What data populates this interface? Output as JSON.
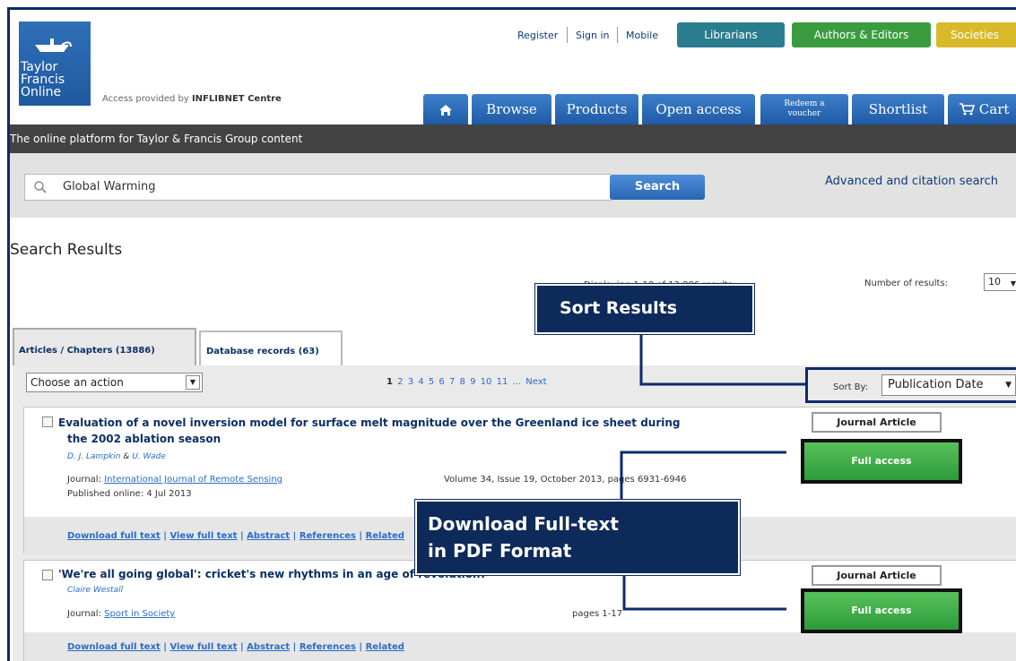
{
  "header": {
    "logo_lines": [
      "Taylor",
      "Francis",
      "Online"
    ],
    "access_prefix": "Access provided by",
    "access_org": "INFLIBNET Centre",
    "links": {
      "register": "Register",
      "sign_in": "Sign in",
      "mobile": "Mobile"
    },
    "pills": {
      "librarians": "Librarians",
      "authors": "Authors & Editors",
      "societies": "Societies"
    },
    "nav": {
      "browse": "Browse",
      "products": "Products",
      "open_access": "Open access",
      "redeem_1": "Redeem a",
      "redeem_2": "voucher",
      "shortlist": "Shortlist",
      "cart": "Cart"
    },
    "tagline": "The online platform for Taylor & Francis Group content"
  },
  "search": {
    "value": "Global Warming",
    "button": "Search",
    "advanced": "Advanced and citation search"
  },
  "results": {
    "heading": "Search Results",
    "count_text": "Displaying 1-10 of 13,886 results",
    "per_page_label": "Number of results:",
    "per_page_value": "10",
    "tabs": {
      "articles": "Articles / Chapters (13886)",
      "database": "Database records (63)"
    },
    "action_select": "Choose an action",
    "pages": [
      "1",
      "2",
      "3",
      "4",
      "5",
      "6",
      "7",
      "8",
      "9",
      "10",
      "11",
      "...",
      "Next"
    ],
    "sort_label": "Sort By:",
    "sort_value": "Publication Date",
    "items": [
      {
        "title_line1": "Evaluation of a novel inversion model for surface melt magnitude over the Greenland ice sheet during",
        "title_line2": "the 2002 ablation season",
        "author1": "D. J. Lampkin",
        "amp": "&",
        "author2": "U. Wade",
        "journal_label": "Journal:",
        "journal": "International Journal of Remote Sensing",
        "volume": "Volume 34, Issue 19, October 2013, pages 6931-6946",
        "published": "Published online: 4 Jul 2013",
        "type": "Journal Article",
        "access": "Full access",
        "links": [
          "Download full text",
          "View full text",
          "Abstract",
          "References",
          "Related"
        ]
      },
      {
        "title_line1": "'We're all going global': cricket's new rhythms in an age of revolution?",
        "author1": "Claire Westall",
        "journal_label": "Journal:",
        "journal": "Sport in Society",
        "pages": "pages 1-17",
        "type": "Journal Article",
        "access": "Full access",
        "links": [
          "Download full text",
          "View full text",
          "Abstract",
          "References",
          "Related"
        ]
      }
    ]
  },
  "annotations": {
    "sort": "Sort Results",
    "download_1": "Download Full-text",
    "download_2": "in PDF Format"
  },
  "colors": {
    "brand": "#2f6fb6",
    "callout": "#0d2a5a",
    "green": "#3aa545",
    "darkbar": "#434343"
  }
}
